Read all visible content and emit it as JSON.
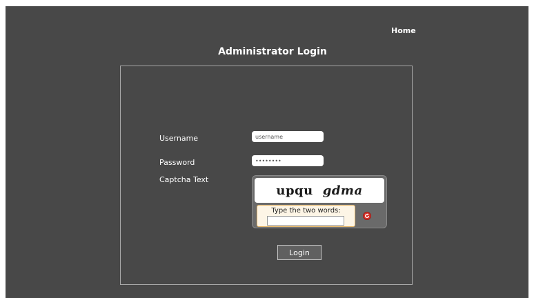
{
  "header": {
    "home_label": "Home",
    "title": "Administrator Login"
  },
  "form": {
    "username_label": "Username",
    "username_value": "username",
    "password_label": "Password",
    "password_value": "password",
    "captcha_label": "Captcha Text",
    "captcha_words": [
      "upqu",
      "gdma"
    ],
    "captcha_instruction": "Type the two words:",
    "captcha_input_value": "",
    "refresh_icon": "refresh-icon",
    "login_label": "Login"
  },
  "colors": {
    "background": "#484848",
    "panel_border": "#a8a8a8",
    "captcha_frame": "#6a6a6a",
    "captcha_entry_bg": "#fdf5e6",
    "refresh_red": "#d8342c"
  }
}
